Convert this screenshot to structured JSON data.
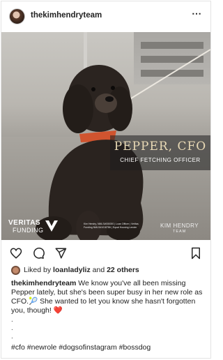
{
  "post": {
    "username": "thekimhendryteam",
    "more_icon": "⋯"
  },
  "image": {
    "name_text": "PEPPER, CFO",
    "title_text": "CHIEF FETCHING OFFICER",
    "logo_left_line1": "VERITAS",
    "logo_left_line2": "FUNDING",
    "logo_right_line1": "KIM HENDRY",
    "logo_right_line2": "TEAM",
    "fine_print": "Kim Hendry, NMLS#000000 | Loan Officer | Veritas Funding NMLS#1018786 | Equal Housing Lender"
  },
  "actions": {
    "icons": [
      "heart-icon",
      "comment-icon",
      "share-icon",
      "bookmark-icon"
    ]
  },
  "likes": {
    "prefix": "Liked by ",
    "user": "loanladyliz",
    "middle": " and ",
    "count_text": "22 others"
  },
  "caption": {
    "username": "thekimhendryteam",
    "text_part1": " We know you've all been missing Pepper lately, but she's been super busy in her new role as CFO.",
    "emoji1": "🎾",
    "text_part2": " She wanted to let you know she hasn't forgotten you, though!",
    "emoji2": "❤️",
    "dots": ".\n.\n.",
    "hashtags": "#cfo #newrole #dogsofinstagram #bossdog"
  },
  "colors": {
    "heart": "#b22d1d",
    "text": "#262626",
    "accent_gold": "#e8d9b5"
  }
}
